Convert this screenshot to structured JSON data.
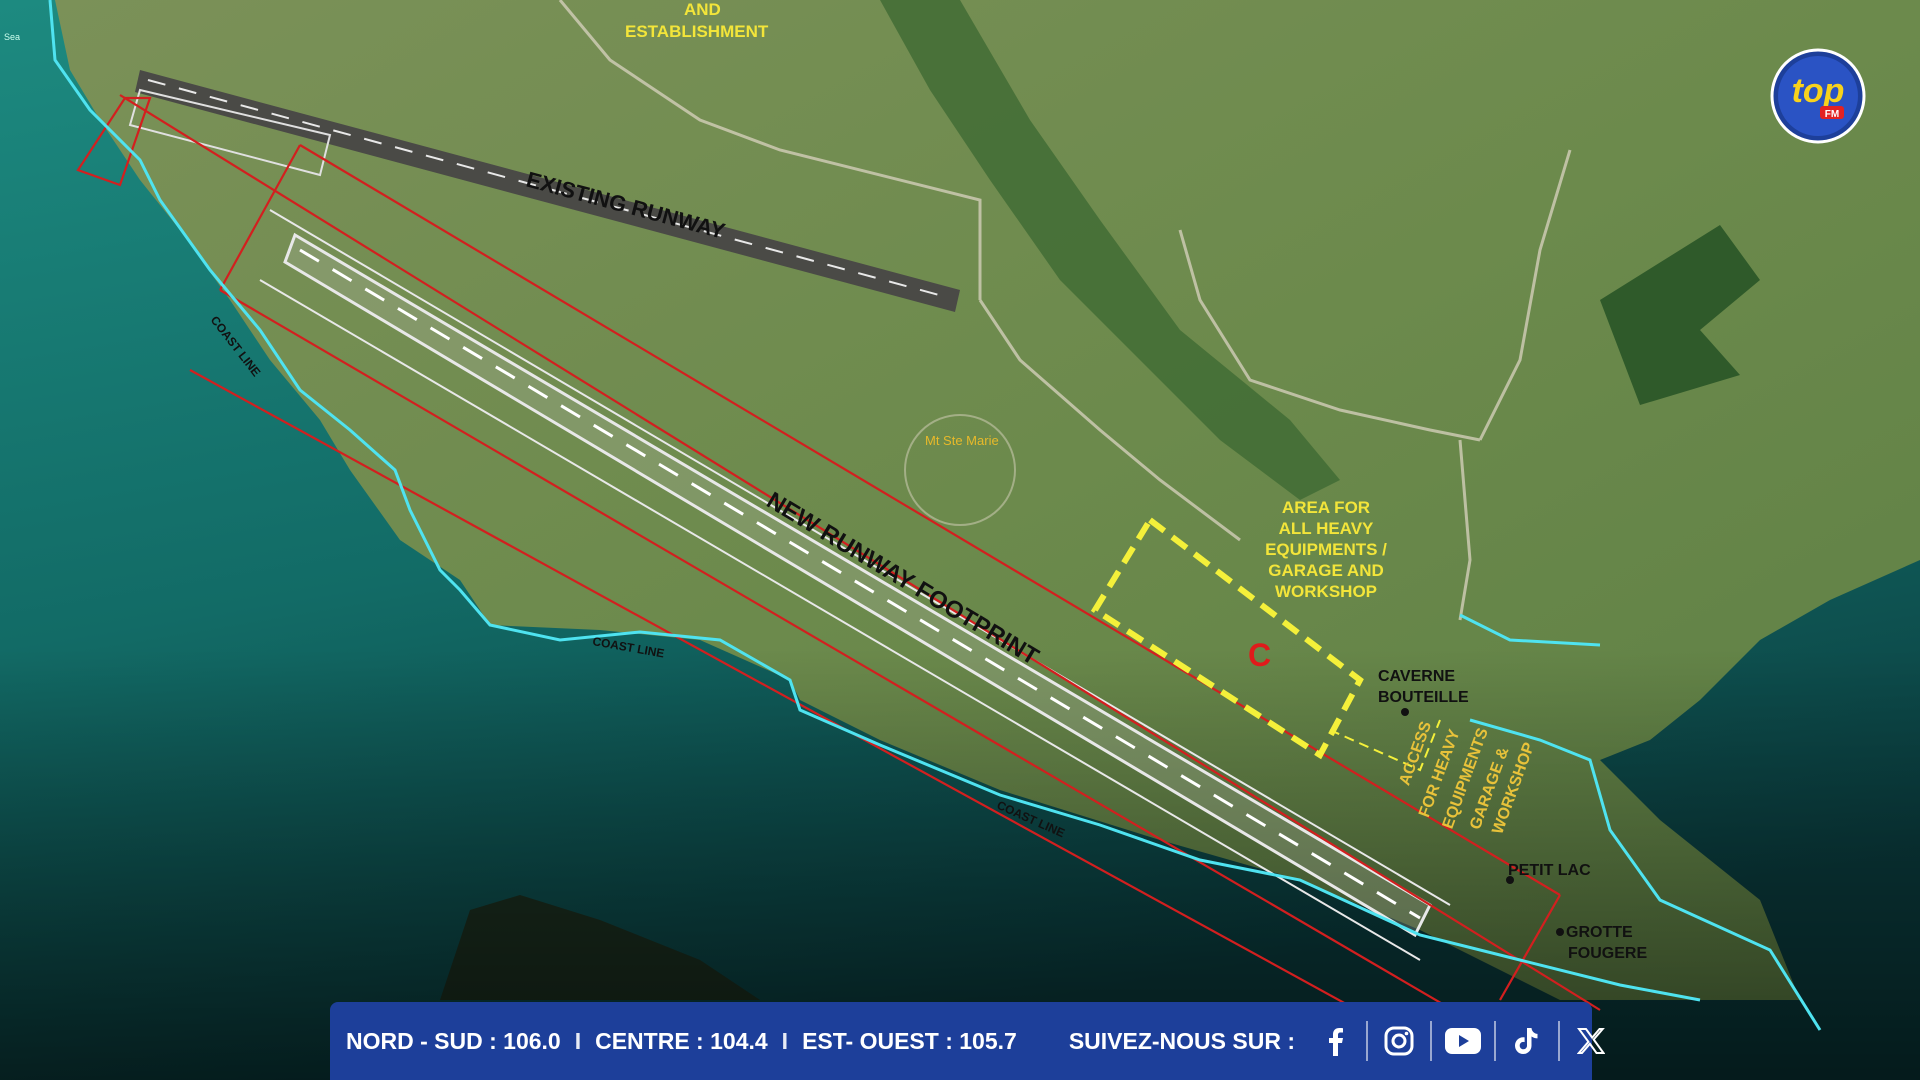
{
  "map": {
    "labels": {
      "and": "AND",
      "establishment": "ESTABLISHMENT",
      "existing_runway": "EXISTING RUNWAY",
      "new_runway": "NEW RUNWAY FOOTPRINT",
      "coast_line": "COAST LINE",
      "mt_ste_marie": "Mt Ste Marie",
      "area_line1": "AREA FOR",
      "area_line2": "ALL HEAVY",
      "area_line3": "EQUIPMENTS /",
      "area_line4": "GARAGE AND",
      "area_line5": "WORKSHOP",
      "zone_c": "C",
      "caverne1": "CAVERNE",
      "caverne2": "BOUTEILLE",
      "access1": "ACCESS",
      "access2": "FOR HEAVY",
      "access3": "EQUIPMENTS",
      "access4": "GARAGE &",
      "access5": "WORKSHOP",
      "petit_lac": "PETIT LAC",
      "grotte1": "GROTTE",
      "grotte2": "FOUGERE",
      "sea": "Sea"
    },
    "colors": {
      "sea": "#12665f",
      "land": "#6f8a4e",
      "coast": "#4fe3f0",
      "footprint": "#d31f1f",
      "dashed_zone": "#f4f03a",
      "label_yellow": "#f3e53a"
    }
  },
  "logo": {
    "text": "top",
    "sub": "FM"
  },
  "footer": {
    "nord_sud": "NORD - SUD : 106.0",
    "sep": "I",
    "centre": "CENTRE : 104.4",
    "est_ouest": "EST- OUEST : 105.7",
    "follow": "SUIVEZ-NOUS SUR :",
    "social": [
      "facebook-icon",
      "instagram-icon",
      "youtube-icon",
      "tiktok-icon",
      "x-icon"
    ]
  }
}
